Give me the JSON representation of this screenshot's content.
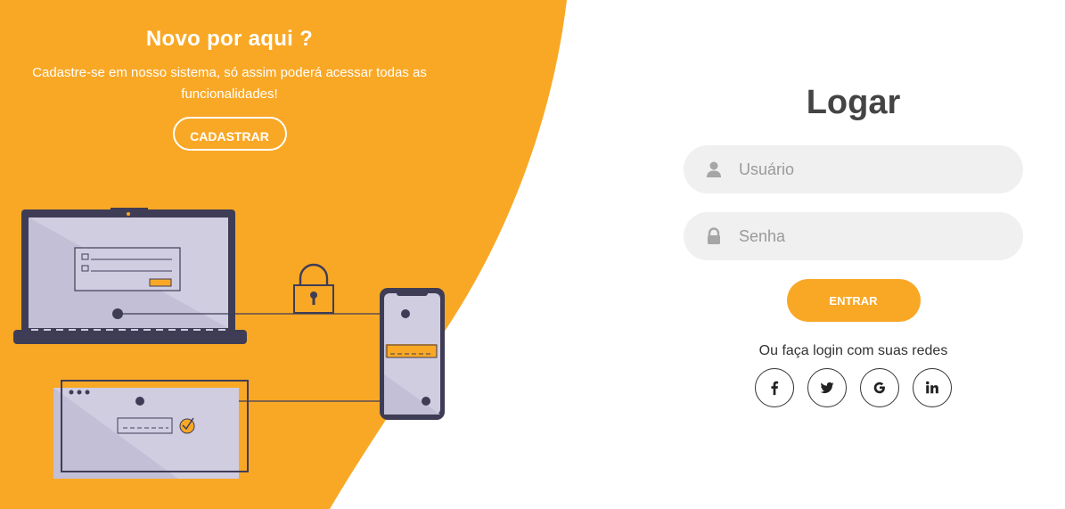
{
  "signup": {
    "title": "Novo por aqui ?",
    "text": "Cadastre-se em nosso sistema, só assim poderá acessar todas as funcionalidades!",
    "button_label": "CADASTRAR"
  },
  "login": {
    "title": "Logar",
    "username": {
      "placeholder": "Usuário",
      "value": "",
      "icon": "user-icon"
    },
    "password": {
      "placeholder": "Senha",
      "value": "",
      "icon": "lock-icon"
    },
    "submit_label": "ENTRAR",
    "social_text": "Ou faça login com suas redes",
    "social": [
      {
        "name": "facebook",
        "icon": "facebook-icon"
      },
      {
        "name": "twitter",
        "icon": "twitter-icon"
      },
      {
        "name": "google",
        "icon": "google-icon"
      },
      {
        "name": "linkedin",
        "icon": "linkedin-icon"
      }
    ]
  },
  "colors": {
    "accent": "#f9a826",
    "device_dark": "#3f3d56",
    "screen": "#d0cde1",
    "field_bg": "#f0f0f0"
  }
}
